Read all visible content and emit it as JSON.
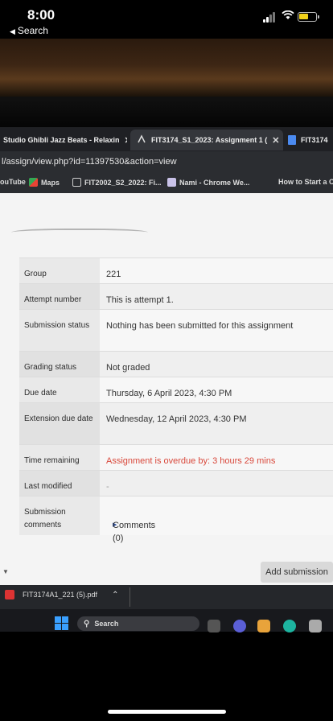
{
  "ios": {
    "time": "8:00",
    "back_label": "Search"
  },
  "browser": {
    "tabs": [
      {
        "title": "Studio Ghibli Jazz Beats - Relaxin",
        "active": false
      },
      {
        "title": "FIT3174_S1_2023: Assignment 1 (",
        "active": true
      },
      {
        "title": "FIT3174",
        "active": false
      }
    ],
    "url": "l/assign/view.php?id=11397530&action=view",
    "bookmarks": [
      {
        "label": "ouTube",
        "icon": "youtube-icon"
      },
      {
        "label": "Maps",
        "icon": "maps-icon"
      },
      {
        "label": "FIT2002_S2_2022: Fi...",
        "icon": "moodle-icon"
      },
      {
        "label": "Nami - Chrome We...",
        "icon": "app-icon"
      },
      {
        "label": "How to Start a C",
        "icon": ""
      }
    ]
  },
  "submission": {
    "rows": [
      {
        "label": "Group",
        "value": "221"
      },
      {
        "label": "Attempt number",
        "value": "This is attempt 1."
      },
      {
        "label": "Submission status",
        "value": "Nothing has been submitted for this assignment"
      },
      {
        "label": "Grading status",
        "value": "Not graded"
      },
      {
        "label": "Due date",
        "value": "Thursday, 6 April 2023, 4:30 PM"
      },
      {
        "label": "Extension due date",
        "value": "Wednesday, 12 April 2023, 4:30 PM"
      },
      {
        "label": "Time remaining",
        "value": "Assignment is overdue by: 3 hours 29 mins"
      },
      {
        "label": "Last modified",
        "value": "-"
      },
      {
        "label": "Submission comments",
        "value": "Comments (0)"
      }
    ],
    "add_button": "Add submission"
  },
  "downloads": {
    "file": "FIT3174A1_221 (5).pdf"
  },
  "taskbar": {
    "search_label": "Search"
  },
  "colors": {
    "overdue": "#d9483b",
    "link": "#4a64a8"
  }
}
